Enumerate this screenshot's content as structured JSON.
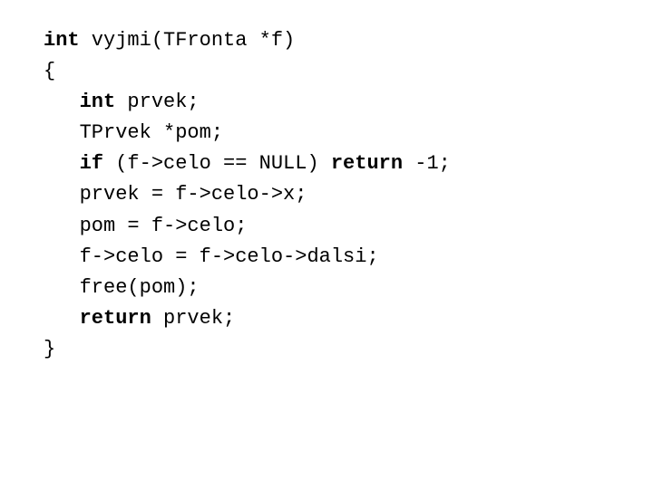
{
  "code": {
    "lines": [
      {
        "id": "line1",
        "parts": [
          {
            "type": "kw",
            "text": "int"
          },
          {
            "type": "normal",
            "text": " vyjmi(TFronta *f)"
          }
        ]
      },
      {
        "id": "line2",
        "parts": [
          {
            "type": "normal",
            "text": "{"
          }
        ]
      },
      {
        "id": "line3",
        "parts": [
          {
            "type": "normal",
            "text": "   "
          },
          {
            "type": "kw",
            "text": "int"
          },
          {
            "type": "normal",
            "text": " prvek;"
          }
        ]
      },
      {
        "id": "line4",
        "parts": [
          {
            "type": "normal",
            "text": "   TPrvek *pom;"
          }
        ]
      },
      {
        "id": "line5",
        "parts": [
          {
            "type": "normal",
            "text": "   "
          },
          {
            "type": "kw",
            "text": "if"
          },
          {
            "type": "normal",
            "text": " (f->celo == NULL) "
          },
          {
            "type": "kw",
            "text": "return"
          },
          {
            "type": "normal",
            "text": " -1;"
          }
        ]
      },
      {
        "id": "line6",
        "parts": [
          {
            "type": "normal",
            "text": "   prvek = f->celo->x;"
          }
        ]
      },
      {
        "id": "line7",
        "parts": [
          {
            "type": "normal",
            "text": "   pom = f->celo;"
          }
        ]
      },
      {
        "id": "line8",
        "parts": [
          {
            "type": "normal",
            "text": "   f->celo = f->celo->dalsi;"
          }
        ]
      },
      {
        "id": "line9",
        "parts": [
          {
            "type": "normal",
            "text": "   free(pom);"
          }
        ]
      },
      {
        "id": "line10",
        "parts": [
          {
            "type": "normal",
            "text": "   "
          },
          {
            "type": "kw",
            "text": "return"
          },
          {
            "type": "normal",
            "text": " prvek;"
          }
        ]
      },
      {
        "id": "line11",
        "parts": [
          {
            "type": "normal",
            "text": "}"
          }
        ]
      }
    ]
  }
}
